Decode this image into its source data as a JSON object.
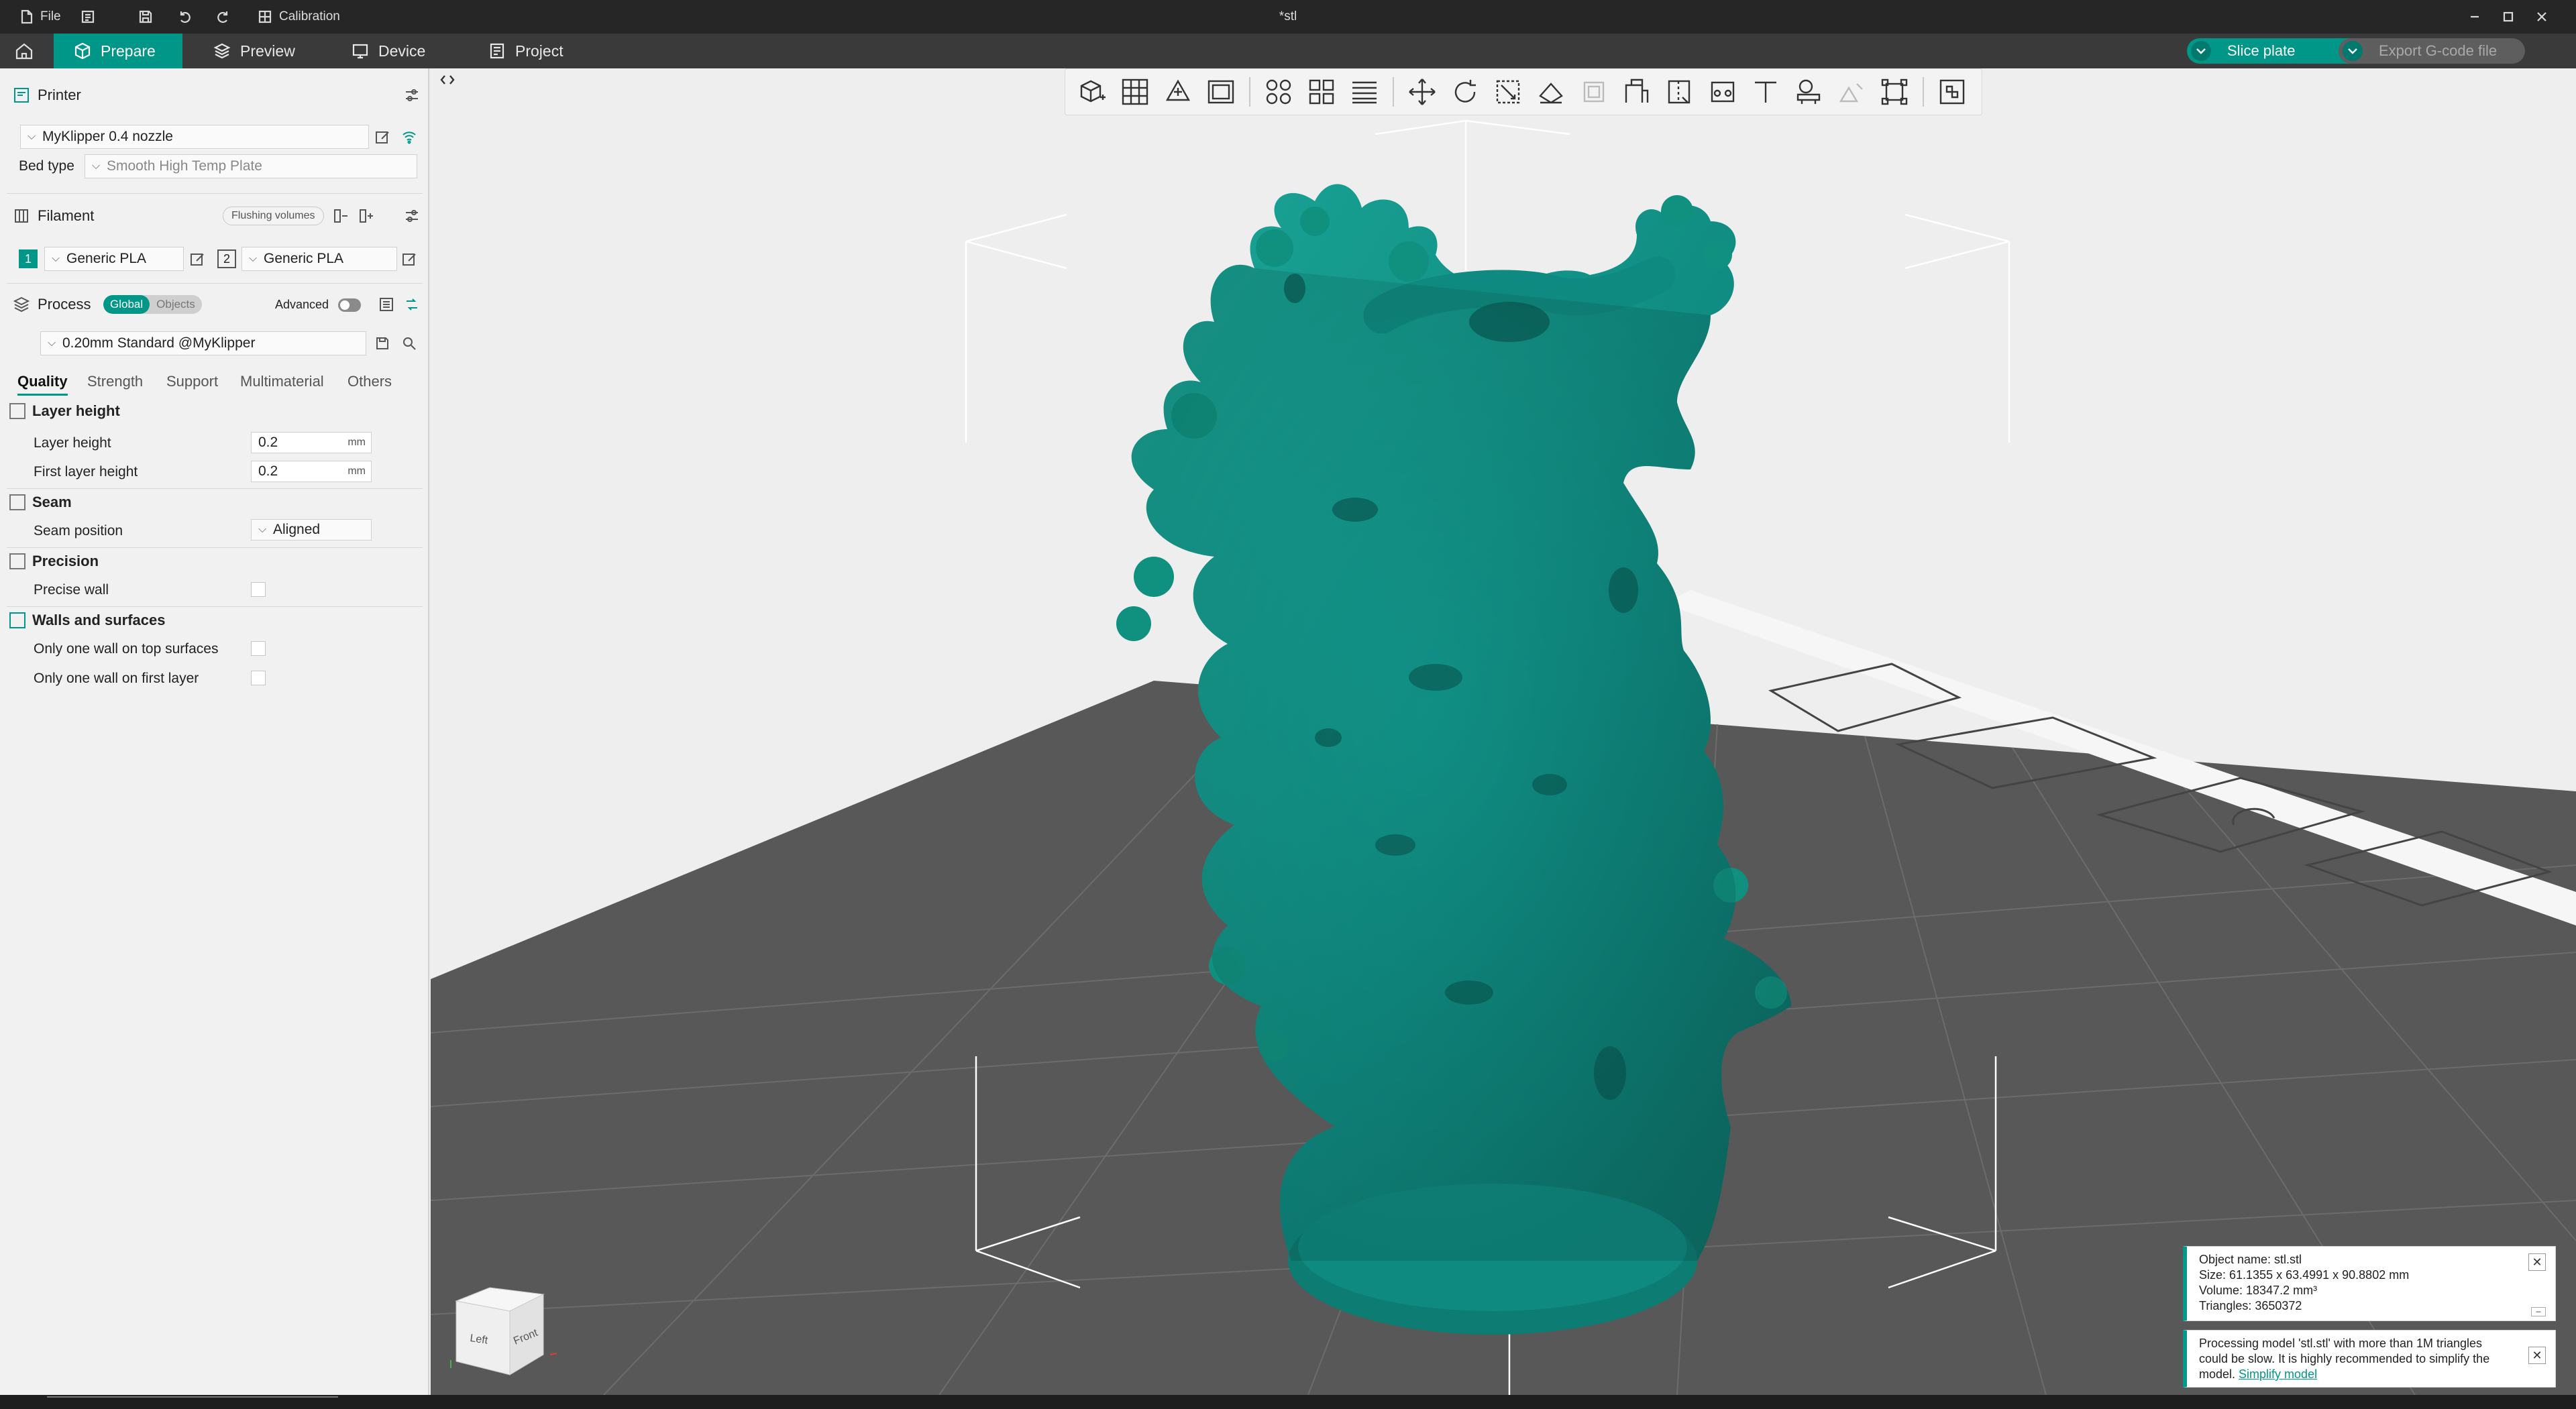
{
  "titlebar": {
    "file_label": "File",
    "calibration_label": "Calibration",
    "window_title": "*stl"
  },
  "tabs": [
    {
      "label": "Prepare",
      "icon": "cube-icon",
      "active": true
    },
    {
      "label": "Preview",
      "icon": "layers-icon",
      "active": false
    },
    {
      "label": "Device",
      "icon": "monitor-icon",
      "active": false
    },
    {
      "label": "Project",
      "icon": "document-icon",
      "active": false
    }
  ],
  "actions": {
    "slice_label": "Slice plate",
    "export_label": "Export G-code file"
  },
  "printer": {
    "section_label": "Printer",
    "name": "MyKlipper 0.4 nozzle",
    "bed_type_label": "Bed type",
    "bed_type_value": "Smooth High Temp Plate"
  },
  "filament": {
    "section_label": "Filament",
    "flushing_label": "Flushing volumes",
    "slots": [
      {
        "index": "1",
        "name": "Generic PLA",
        "color": "#009688"
      },
      {
        "index": "2",
        "name": "Generic PLA",
        "color": "#f2f2f2"
      }
    ]
  },
  "process": {
    "section_label": "Process",
    "seg_global": "Global",
    "seg_objects": "Objects",
    "advanced_label": "Advanced",
    "preset": "0.20mm Standard @MyKlipper",
    "tabs": [
      "Quality",
      "Strength",
      "Support",
      "Multimaterial",
      "Others"
    ],
    "groups": {
      "layer_height": {
        "title": "Layer height",
        "layer_height_label": "Layer height",
        "layer_height_value": "0.2",
        "first_layer_label": "First layer height",
        "first_layer_value": "0.2",
        "unit": "mm"
      },
      "seam": {
        "title": "Seam",
        "position_label": "Seam position",
        "position_value": "Aligned"
      },
      "precision": {
        "title": "Precision",
        "precise_wall_label": "Precise wall"
      },
      "walls": {
        "title": "Walls and surfaces",
        "one_wall_top_label": "Only one wall on top surfaces",
        "one_wall_first_label": "Only one wall on first layer"
      }
    }
  },
  "viewcube": {
    "left": "Left",
    "front": "Front"
  },
  "notifications": {
    "object_name": "Object name: stl.stl",
    "size": "Size: 61.1355 x 63.4991 x 90.8802 mm",
    "volume": "Volume: 18347.2 mm³",
    "triangles": "Triangles: 3650372",
    "warning_text": "Processing model 'stl.stl' with more than 1M triangles could be slow. It is highly recommended to simplify the model.",
    "warning_link": "Simplify model"
  },
  "colors": {
    "accent": "#009688",
    "model": "#0f8a80",
    "plate": "#5a5a5a"
  }
}
